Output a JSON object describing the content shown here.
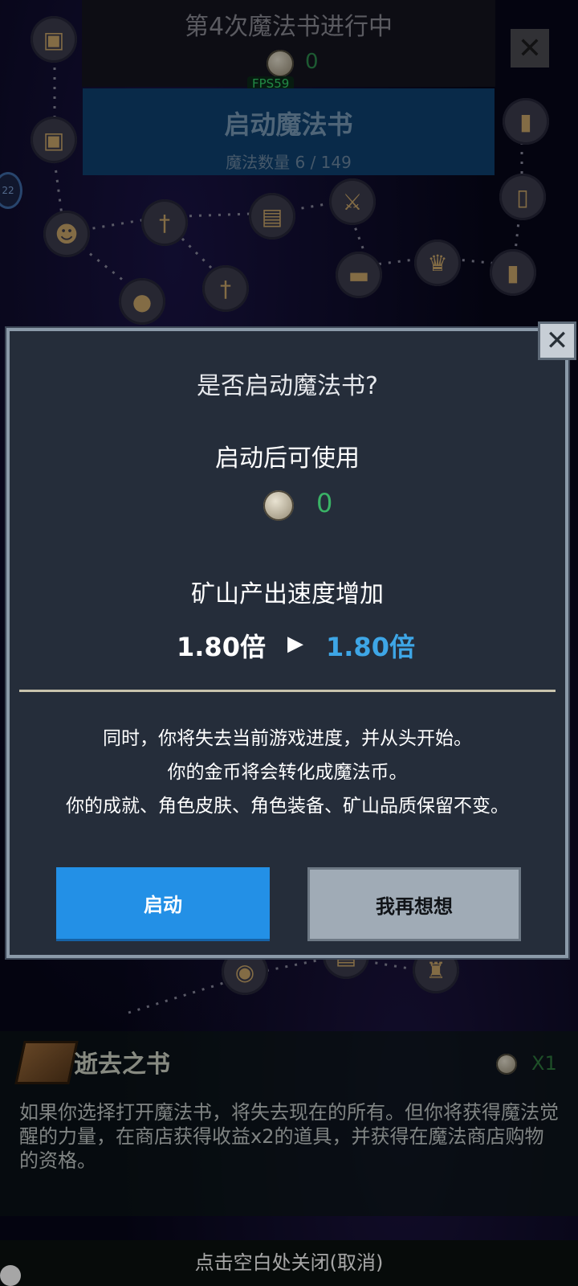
{
  "header": {
    "title": "第4次魔法书进行中",
    "coin_count": "0",
    "fps": "FPS59"
  },
  "start_panel": {
    "title": "启动魔法书",
    "subtitle": "魔法数量 6 / 149"
  },
  "side_badge": "22",
  "dialog": {
    "title": "是否启动魔法书?",
    "usable_label": "启动后可使用",
    "coin_amount": "0",
    "mine_label": "矿山产出速度增加",
    "speed_from": "1.80倍",
    "speed_to": "1.80倍",
    "description": [
      "同时，你将失去当前游戏进度，并从头开始。",
      "你的金币将会转化成魔法币。",
      "你的成就、角色皮肤、角色装备、矿山品质保留不变。"
    ],
    "confirm_label": "启动",
    "cancel_label": "我再想想"
  },
  "book": {
    "name": "逝去之书",
    "multiplier": "X1",
    "description": "如果你选择打开魔法书，将失去现在的所有。但你将获得魔法觉醒的力量，在商店获得收益x2的道具，并获得在魔法商店购物的资格。"
  },
  "bottom": {
    "hint": "点击空白处关闭(取消)"
  },
  "colors": {
    "confirm_button": "#2390e6",
    "cancel_button": "#a0abb6",
    "coin_count": "#3ab366",
    "speed_to": "#3ea6e6"
  }
}
